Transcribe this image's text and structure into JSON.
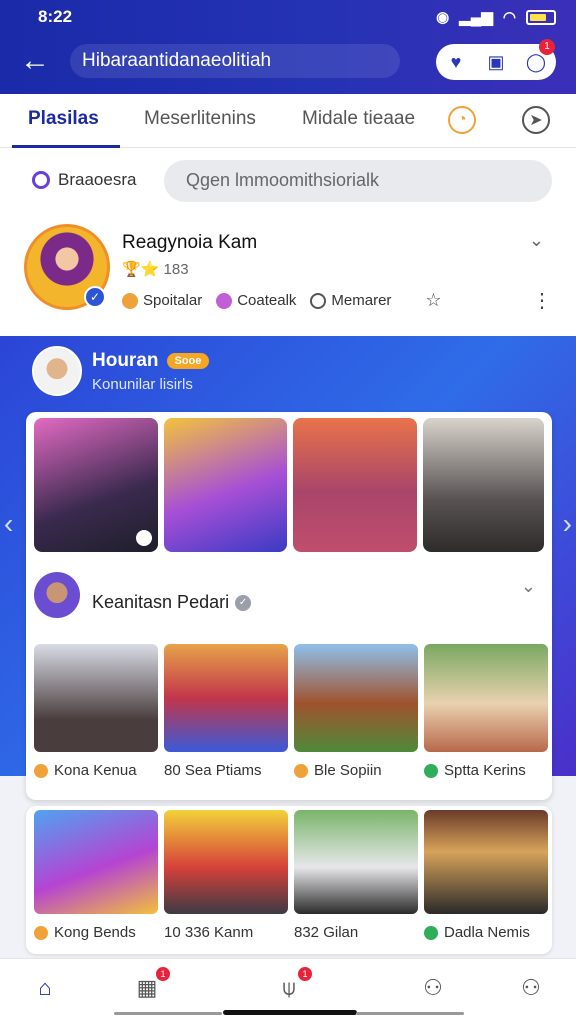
{
  "status_bar": {
    "time": "8:22"
  },
  "header": {
    "title": "Hibaraantidanaeolitiah",
    "actions": [
      {
        "icon": "heart-icon",
        "badge": ""
      },
      {
        "icon": "store-icon",
        "badge": ""
      },
      {
        "icon": "chat-icon",
        "badge": "1"
      }
    ]
  },
  "tabs": [
    {
      "label": "Plasilas",
      "active": true
    },
    {
      "label": "Meserlitenins",
      "active": false
    },
    {
      "label": "Midale tieaae",
      "active": false
    }
  ],
  "search": {
    "scope_label": "Braaoesra",
    "placeholder": "Qgen lmmoomithsiorialk"
  },
  "profile": {
    "name": "Reagynoia Kam",
    "meta": "🏆⭐ 183",
    "actions": [
      {
        "label": "Spoitalar",
        "icon": "spark-icon",
        "color": "#f0a23a"
      },
      {
        "label": "Coatealk",
        "icon": "smile-icon",
        "color": "#c25fd4"
      },
      {
        "label": "Memarer",
        "icon": "member-icon",
        "color": "#555555"
      }
    ]
  },
  "banner": {
    "title": "Houran",
    "tag": "Sooe",
    "subtitle": "Konunilar lisirls"
  },
  "group": {
    "title": "Keanitasn Pedari"
  },
  "grid_row_1": [
    {
      "label": "Kona Kenua",
      "icon_color": "#f0a23a"
    },
    {
      "label": "80 Sea Ptiams",
      "icon_color": ""
    },
    {
      "label": "Ble Sopiin",
      "icon_color": "#f0a23a"
    },
    {
      "label": "Sptta Kerins",
      "icon_color": "#2fae5a"
    }
  ],
  "grid_row_2": [
    {
      "label": "Kong Bends",
      "icon_color": "#f0a23a"
    },
    {
      "label": "10 336 Kanm",
      "icon_color": ""
    },
    {
      "label": "832 Gilan",
      "icon_color": ""
    },
    {
      "label": "Dadla Nemis",
      "icon_color": "#2fae5a"
    }
  ],
  "bottom_nav": [
    {
      "icon": "home-icon",
      "badge": "",
      "active": true
    },
    {
      "icon": "grid-icon",
      "badge": "1",
      "active": false
    },
    {
      "icon": "tree-icon",
      "badge": "1",
      "active": false
    },
    {
      "icon": "profile-icon",
      "badge": "",
      "active": false
    },
    {
      "icon": "account-icon",
      "badge": "",
      "active": false
    }
  ]
}
